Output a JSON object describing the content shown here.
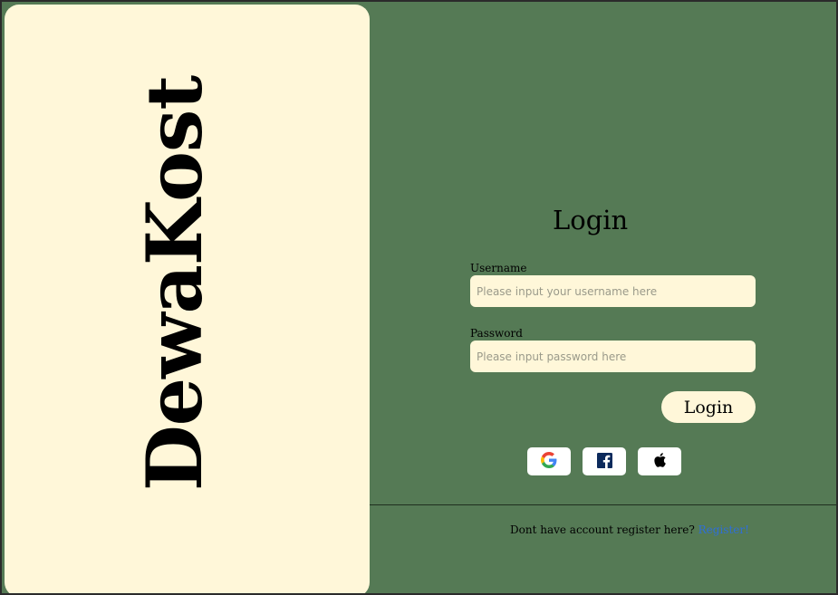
{
  "brand": {
    "name": "DewaKost"
  },
  "login": {
    "title": "Login",
    "username_label": "Username",
    "username_placeholder": "Please input your username here",
    "password_label": "Password",
    "password_placeholder": "Please input password here",
    "submit_label": "Login"
  },
  "social": [
    {
      "icon": "google-icon"
    },
    {
      "icon": "facebook-icon"
    },
    {
      "icon": "apple-icon"
    }
  ],
  "footer": {
    "prompt": "Dont have account register here?",
    "register_link": "Register!"
  },
  "colors": {
    "background": "#557a55",
    "panel": "#fff7d9",
    "link": "#2f6fd6"
  }
}
